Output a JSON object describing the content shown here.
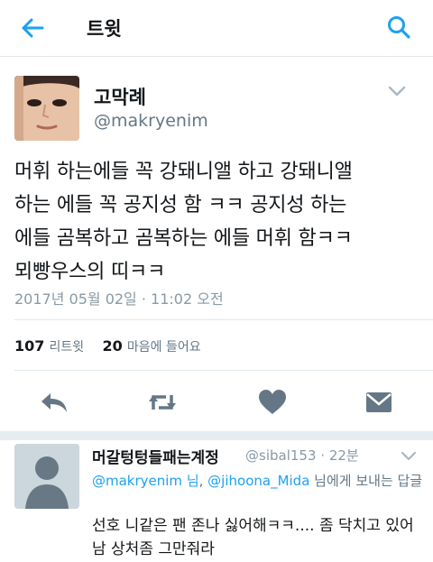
{
  "topbar": {
    "title": "트윗",
    "back_icon": "arrow-left-icon",
    "search_icon": "search-icon",
    "accent": "#1da1f2"
  },
  "tweet": {
    "author_name": "고막례",
    "author_handle": "@makryenim",
    "text_lines": [
      "머휘 하는에들 꼭 강돼니앨 하고 강돼니앨",
      "하는 에들 꼭 공지성 함 ㅋㅋ 공지성 하는",
      "에들 곰복하고 곰복하는 에들 머휘 함ㅋㅋ",
      "뫼빵우스의 띠ㅋㅋ"
    ],
    "timestamp": "2017년 05월 02일 · 11:02 오전",
    "retweet_count": "107",
    "retweet_label": "리트윗",
    "like_count": "20",
    "like_label": "마음에 들어요"
  },
  "actions": [
    "reply-icon",
    "retweet-icon",
    "heart-icon",
    "message-icon"
  ],
  "reply": {
    "author_name": "머갈텅텅들패는계정",
    "author_handle": "@sibal153",
    "time": "22분",
    "reply_to_mention1": "@makryenim 님",
    "reply_to_separator": ", ",
    "reply_to_mention2": "@jihoona_Mida",
    "reply_to_suffix": " 님에게 보내는 답글",
    "text": "선호 니같은 팬 존나 싫어해ㅋㅋ.... 좀 닥치고 있어 남 상처좀 그만줘라"
  }
}
